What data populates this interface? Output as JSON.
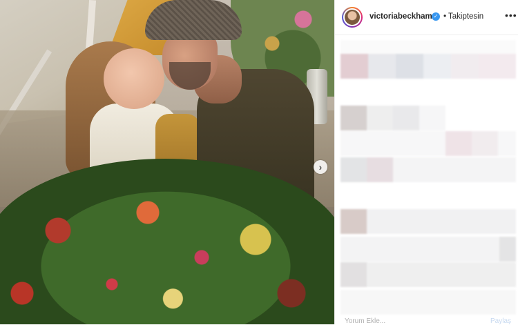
{
  "post": {
    "username": "victoriabeckham",
    "verified_icon": "verified-badge-icon",
    "separator": "•",
    "follow_status": "Takiptesin",
    "more_label": "•••",
    "next_arrow": "›",
    "footer_left": "Yorum Ekle...",
    "footer_right": "Paylaş"
  },
  "colors": {
    "verified_blue": "#3897f0",
    "border": "#efefef",
    "text": "#262626"
  }
}
